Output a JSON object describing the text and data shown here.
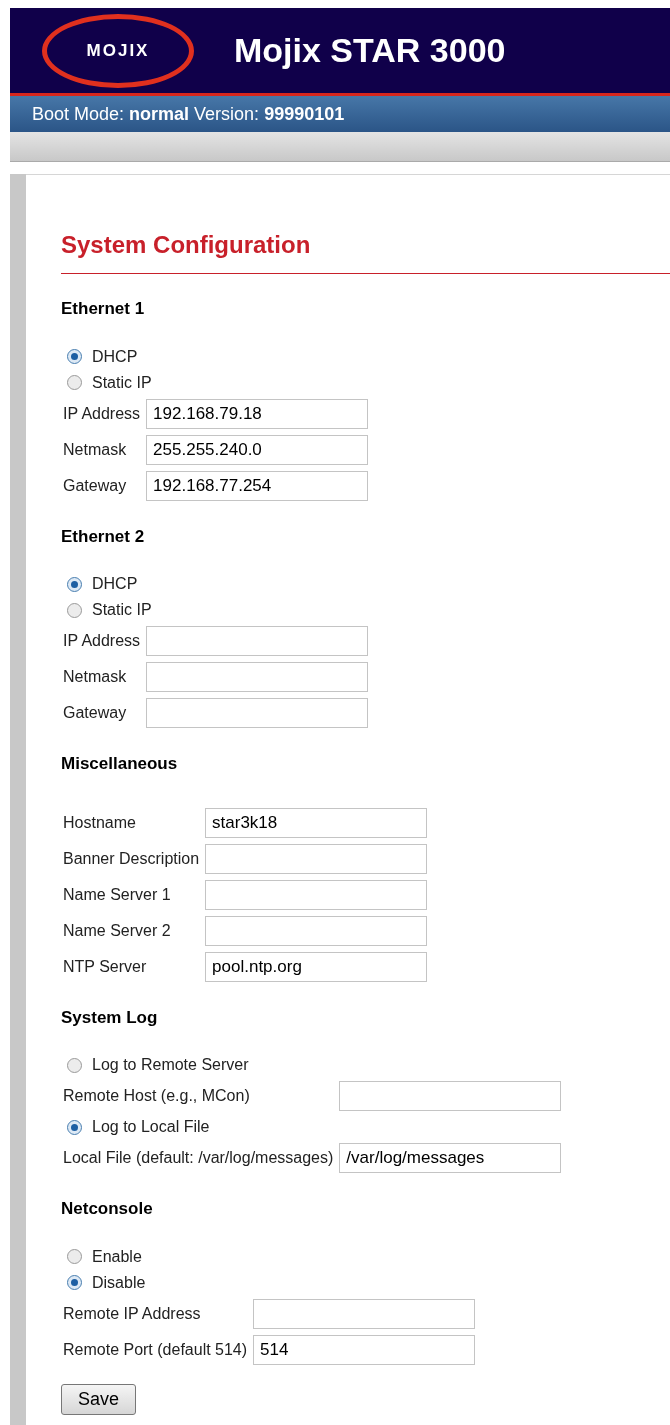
{
  "header": {
    "logo_text": "MOJIX",
    "title": "Mojix STAR 3000"
  },
  "status_bar": "Boot Mode: **normal** Version: **99990101**",
  "page_title": "System Configuration",
  "sections": [
    {
      "title": "Ethernet 1",
      "items": [
        {
          "kind": "radio",
          "label": "DHCP",
          "selected": true
        },
        {
          "kind": "radio",
          "label": "Static IP",
          "selected": false
        },
        {
          "kind": "field",
          "label": "IP Address",
          "value": "192.168.79.18"
        },
        {
          "kind": "field",
          "label": "Netmask",
          "value": "255.255.240.0"
        },
        {
          "kind": "field",
          "label": "Gateway",
          "value": "192.168.77.254"
        }
      ]
    },
    {
      "title": "Ethernet 2",
      "items": [
        {
          "kind": "radio",
          "label": "DHCP",
          "selected": true
        },
        {
          "kind": "radio",
          "label": "Static IP",
          "selected": false
        },
        {
          "kind": "field",
          "label": "IP Address"
        },
        {
          "kind": "field",
          "label": "Netmask"
        },
        {
          "kind": "field",
          "label": "Gateway"
        }
      ]
    },
    {
      "title": "Miscellaneous",
      "items": [
        {
          "kind": "field",
          "label": "Hostname",
          "value": "star3k18"
        },
        {
          "kind": "field",
          "label": "Banner Description"
        },
        {
          "kind": "field",
          "label": "Name Server 1"
        },
        {
          "kind": "field",
          "label": "Name Server 2"
        },
        {
          "kind": "field",
          "label": "NTP Server",
          "value": "pool.ntp.org"
        }
      ]
    },
    {
      "title": "System Log",
      "items": [
        {
          "kind": "radio",
          "label": "Log to Remote Server",
          "selected": false
        },
        {
          "kind": "field",
          "label": "Remote Host (e.g., MCon)"
        },
        {
          "kind": "radio",
          "label": "Log to Local File",
          "selected": true
        },
        {
          "kind": "field",
          "label": "Local File (default: /var/log/messages)",
          "value": "/var/log/messages"
        }
      ]
    },
    {
      "title": "Netconsole",
      "items": [
        {
          "kind": "radio",
          "label": "Enable",
          "selected": false
        },
        {
          "kind": "radio",
          "label": "Disable",
          "selected": true
        },
        {
          "kind": "field",
          "label": "Remote IP Address"
        },
        {
          "kind": "field",
          "label": "Remote Port (default 514)",
          "value": "514"
        }
      ]
    }
  ],
  "save_button": "Save"
}
